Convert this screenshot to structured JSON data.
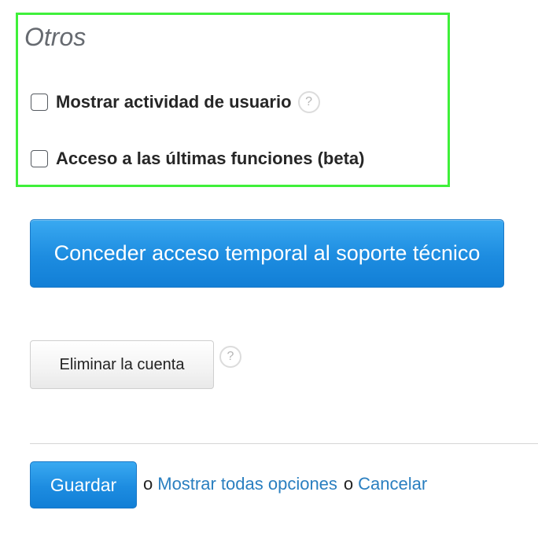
{
  "otros": {
    "title": "Otros",
    "options": [
      {
        "label": "Mostrar actividad de usuario",
        "checked": false,
        "help": "?"
      },
      {
        "label": "Acceso a las últimas funciones (beta)",
        "checked": false
      }
    ],
    "highlight_color": "#3ff03a"
  },
  "support_button": {
    "label": "Conceder acceso temporal al soporte técnico"
  },
  "delete_account": {
    "label": "Eliminar la cuenta",
    "help": "?"
  },
  "footer": {
    "save_label": "Guardar",
    "or_1": "o",
    "show_all_label": "Mostrar todas opciones",
    "or_2": "o",
    "cancel_label": "Cancelar"
  },
  "colors": {
    "primary": "#1d8ce0",
    "link": "#2a7fc0"
  },
  "icons": {
    "help": "help-icon"
  }
}
